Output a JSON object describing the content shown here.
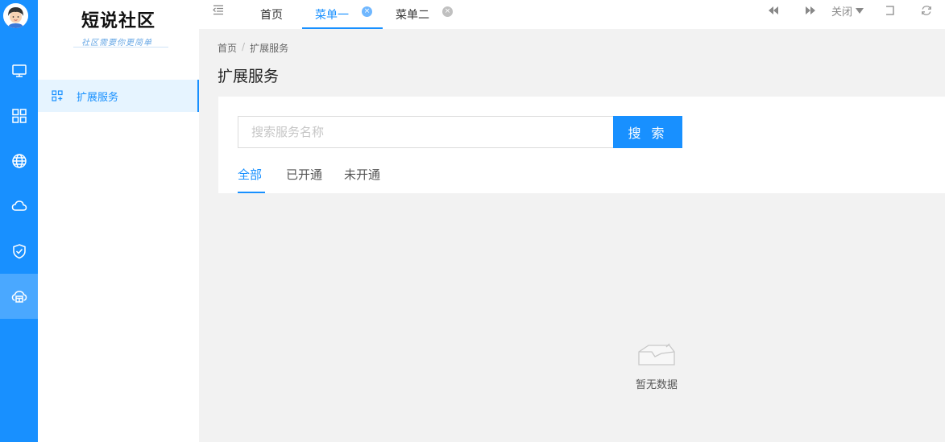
{
  "logo": {
    "title": "短说社区",
    "subtitle": "社区需要你更简单"
  },
  "rail": {
    "icons": [
      "monitor-icon",
      "apps-grid-icon",
      "globe-icon",
      "cloud-icon",
      "shield-check-icon",
      "cloud-store-icon"
    ]
  },
  "sidebar": {
    "items": [
      {
        "label": "扩展服务",
        "icon": "apps-icon",
        "active": true
      }
    ]
  },
  "tabs": [
    {
      "label": "首页",
      "active": false,
      "closable": false
    },
    {
      "label": "菜单一",
      "active": true,
      "closable": true
    },
    {
      "label": "菜单二",
      "active": false,
      "closable": true
    }
  ],
  "tab_close_glyph": "×",
  "toolbar": {
    "close_label": "关闭"
  },
  "breadcrumb": {
    "home": "首页",
    "separator": "/",
    "current": "扩展服务"
  },
  "page": {
    "title": "扩展服务"
  },
  "search": {
    "placeholder": "搜索服务名称",
    "value": "",
    "button_label": "搜 索"
  },
  "filter_tabs": [
    {
      "label": "全部",
      "active": true
    },
    {
      "label": "已开通",
      "active": false
    },
    {
      "label": "未开通",
      "active": false
    }
  ],
  "empty_state": {
    "text": "暂无数据"
  },
  "colors": {
    "primary": "#1890ff",
    "rail_active": "#4aa8ff",
    "sidebar_active_bg": "#e6f4ff"
  }
}
